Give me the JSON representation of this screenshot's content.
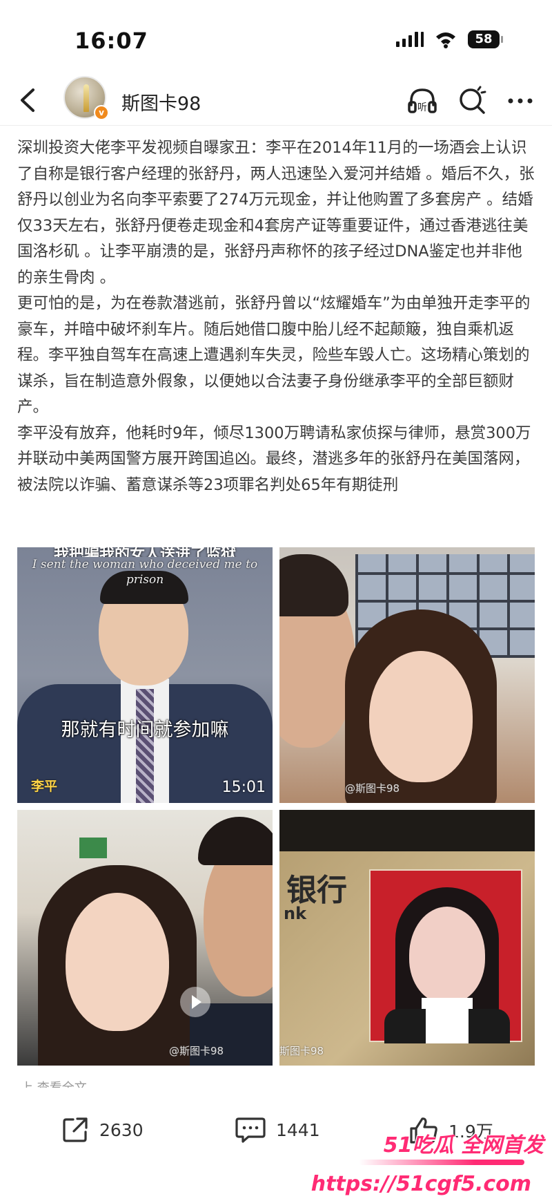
{
  "status_bar": {
    "time": "16:07",
    "battery": "58"
  },
  "header": {
    "username": "斯图卡98",
    "icons": [
      "back-chevron-icon",
      "listen-headphones-icon",
      "search-icon",
      "more-icon"
    ],
    "listen_label": "听"
  },
  "post": {
    "paragraphs": [
      "深圳投资大佬李平发视频自曝家丑：李平在2014年11月的一场酒会上认识了自称是银行客户经理的张舒丹，两人迅速坠入爱河并结婚 。婚后不久，张舒丹以创业为名向李平索要了274万元现金，并让他购置了多套房产 。结婚仅33天左右，张舒丹便卷走现金和4套房产证等重要证件，通过香港逃往美国洛杉矶 。让李平崩溃的是，张舒丹声称怀的孩子经过DNA鉴定也并非他的亲生骨肉 。",
      "更可怕的是，为在卷款潜逃前，张舒丹曾以“炫耀婚车”为由单独开走李平的豪车，并暗中破坏刹车片。随后她借口腹中胎儿经不起颠簸，独自乘机返程。李平独自驾车在高速上遭遇刹车失灵，险些车毁人亡。这场精心策划的谋杀，旨在制造意外假象，以便她以合法妻子身份继承李平的全部巨额财产。",
      "李平没有放弃，他耗时9年，倾尽1300万聘请私家侦探与律师，悬赏300万并联动中美两国警方展开跨国追凶。最终，潜逃多年的张舒丹在美国落网，被法院以诈骗、蓄意谋杀等23项罪名判处65年有期徒刑"
    ]
  },
  "images": {
    "tile1": {
      "caption_cn": "我把骗我的女人送进了监狱",
      "caption_en": "I sent the woman who deceived me to prison",
      "subtitle": "那就有时间就参加嘛",
      "name_tag": "李平",
      "duration": "15:01"
    },
    "tile2": {
      "watermark": "@斯图卡98"
    },
    "tile3": {
      "watermark": "@斯图卡98"
    },
    "tile4": {
      "bank_text": "银行",
      "bank_sub": "nk",
      "watermark": "斯图卡98"
    }
  },
  "more_hint": "上 查看全文",
  "actions": {
    "share_count": "2630",
    "comment_count": "1441",
    "like_count": "1.9万"
  },
  "promo": {
    "line1": "51吃瓜 全网首发",
    "line2": "https://51cgf5.com"
  },
  "colors": {
    "promo_pink": "#ff2b74",
    "verify_orange": "#f08a1d",
    "text": "#3a3a3a"
  }
}
